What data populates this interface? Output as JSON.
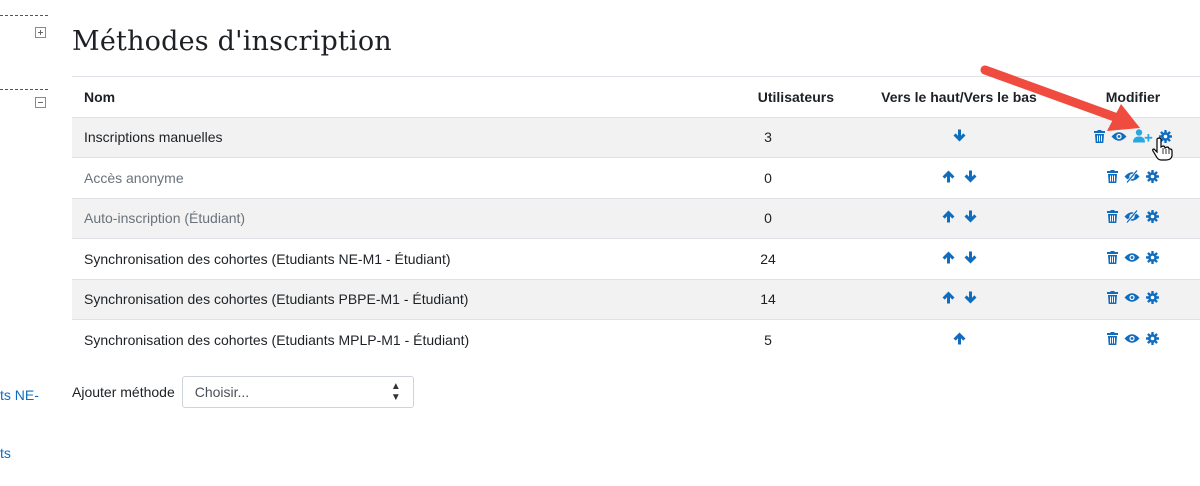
{
  "page_title": "Méthodes d'inscription",
  "sidebar": {
    "link1": "ts NE-",
    "link2": "ts"
  },
  "table": {
    "headers": {
      "name": "Nom",
      "users": "Utilisateurs",
      "move": "Vers le haut/Vers le bas",
      "edit": "Modifier"
    },
    "rows": [
      {
        "name": "Inscriptions manuelles",
        "users": "3",
        "up": false,
        "down": true,
        "visible": true,
        "enrol_users": true
      },
      {
        "name": "Accès anonyme",
        "users": "0",
        "up": true,
        "down": true,
        "visible": false,
        "enrol_users": false
      },
      {
        "name": "Auto-inscription (Étudiant)",
        "users": "0",
        "up": true,
        "down": true,
        "visible": false,
        "enrol_users": false
      },
      {
        "name": "Synchronisation des cohortes (Etudiants NE-M1 - Étudiant)",
        "users": "24",
        "up": true,
        "down": true,
        "visible": true,
        "enrol_users": false
      },
      {
        "name": "Synchronisation des cohortes (Etudiants PBPE-M1 - Étudiant)",
        "users": "14",
        "up": true,
        "down": true,
        "visible": true,
        "enrol_users": false
      },
      {
        "name": "Synchronisation des cohortes (Etudiants MPLP-M1 - Étudiant)",
        "users": "5",
        "up": true,
        "down": false,
        "visible": true,
        "enrol_users": false
      }
    ]
  },
  "add_method": {
    "label": "Ajouter méthode",
    "select_value": "Choisir..."
  },
  "colors": {
    "link": "#0f6cbf",
    "annotation_arrow": "#ef4b3f",
    "row_stripe": "#f2f2f2"
  }
}
